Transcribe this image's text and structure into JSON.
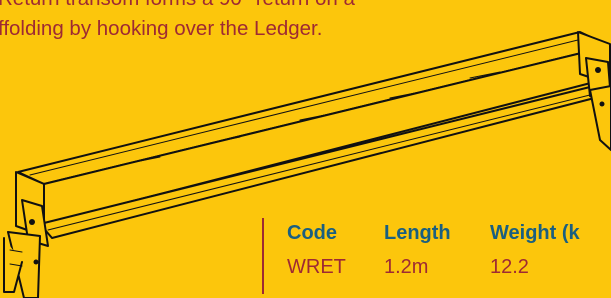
{
  "description": {
    "line1": "Return transom forms a 90° return on a",
    "line2": "ffolding by hooking over the Ledger."
  },
  "spec_table": {
    "headers": [
      "Code",
      "Length",
      "Weight (k"
    ],
    "row": [
      "WRET",
      "1.2m",
      "12.2"
    ]
  },
  "colors": {
    "background": "#fcc60c",
    "description_text": "#9e2a33",
    "header_text": "#1a5f80",
    "value_text": "#9e2a33",
    "divider": "#9e2a33"
  },
  "illustration": {
    "subject": "return transom line drawing"
  }
}
